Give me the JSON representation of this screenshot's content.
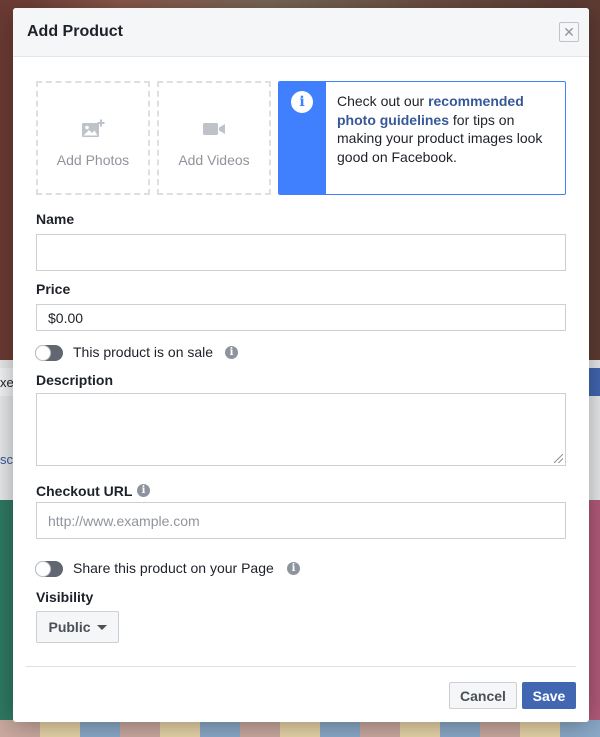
{
  "modal": {
    "title": "Add Product",
    "close_icon": "close-icon"
  },
  "media": {
    "photos": {
      "label": "Add Photos",
      "icon": "add-photo-icon"
    },
    "videos": {
      "label": "Add Videos",
      "icon": "video-camera-icon"
    }
  },
  "info": {
    "icon": "info-icon",
    "text_before": "Check out our ",
    "link_text": "recommended photo guidelines",
    "text_after": " for tips on making your product images look good on Facebook."
  },
  "form": {
    "name_label": "Name",
    "name_value": "",
    "price_label": "Price",
    "price_value": "$0.00",
    "on_sale_label": "This product is on sale",
    "description_label": "Description",
    "description_value": "",
    "checkout_label": "Checkout URL",
    "checkout_placeholder": "http://www.example.com",
    "share_label": "Share this product on your Page",
    "visibility_label": "Visibility",
    "visibility_value": "Public"
  },
  "buttons": {
    "cancel": "Cancel",
    "save": "Save"
  },
  "background": {
    "left_text_1": "xe",
    "left_text_2": "sc"
  },
  "colors": {
    "accent": "#4267b2",
    "info_blue": "#4080ff",
    "link": "#365899"
  }
}
